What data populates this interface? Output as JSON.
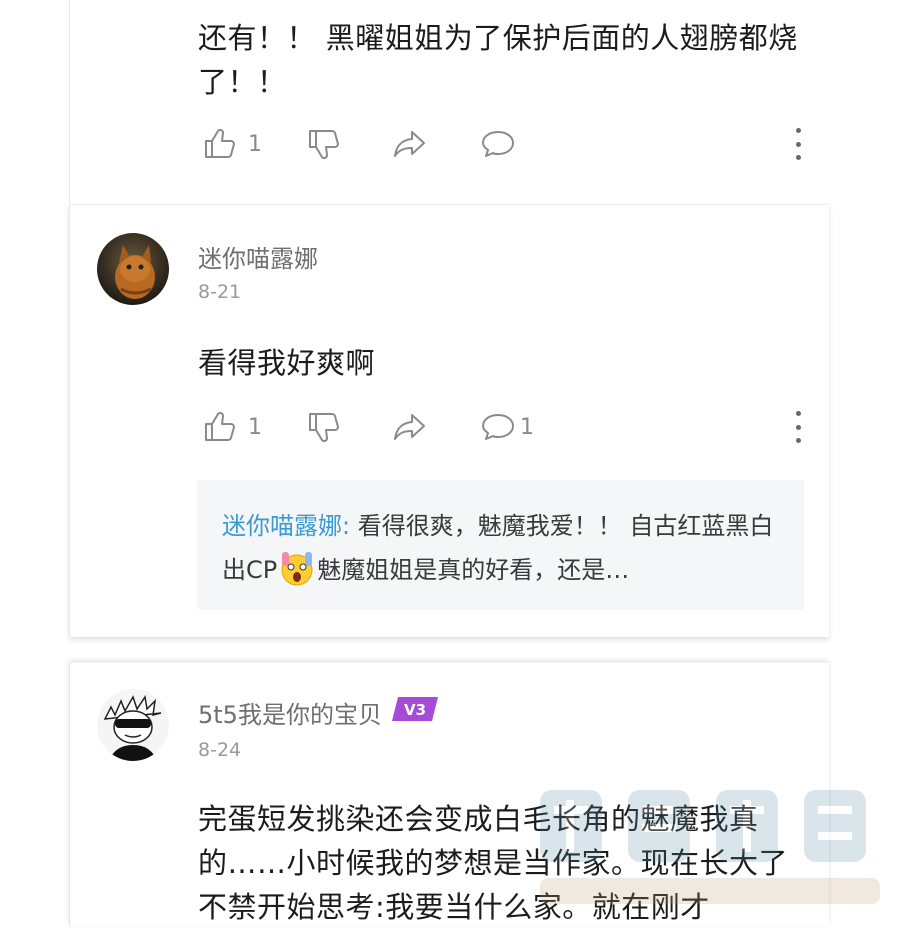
{
  "page": {
    "edge_glyph": ")"
  },
  "comments": [
    {
      "body": "还有！！ 黑曜姐姐为了保护后面的人翅膀都烧了！！",
      "likes": "1"
    },
    {
      "username": "迷你喵露娜",
      "date": "8-21",
      "body": "看得我好爽啊",
      "likes": "1",
      "replies": "1",
      "reply_preview": {
        "author": "迷你喵露娜:",
        "text_before_emoji": " 看得很爽，魅魔我爱！！ 自古红蓝黑白出CP",
        "text_after_emoji": "魅魔姐姐是真的好看，还是…"
      }
    },
    {
      "username": "5t5我是你的宝贝",
      "badge": "V3",
      "date": "8-24",
      "body": "完蛋短发挑染还会变成白毛长角的魅魔我真的……小时候我的梦想是当作家。现在长大了不禁开始思考:我要当什么家。就在刚才"
    }
  ],
  "icons": {
    "like": "thumbs-up-icon",
    "dislike": "thumbs-down-icon",
    "share": "share-arrow-icon",
    "comment": "comment-bubble-icon",
    "more": "more-vertical-icon",
    "emoji": "shocked-face-emoji-icon"
  },
  "colors": {
    "reply_name": "#3a9ad3",
    "reply_bg": "#f4f6f8",
    "badge": "#a64bd6",
    "icon": "#8a8a8a"
  },
  "watermark": {
    "cn": "笔尖数据",
    "en": "ACloudMerge.com"
  }
}
